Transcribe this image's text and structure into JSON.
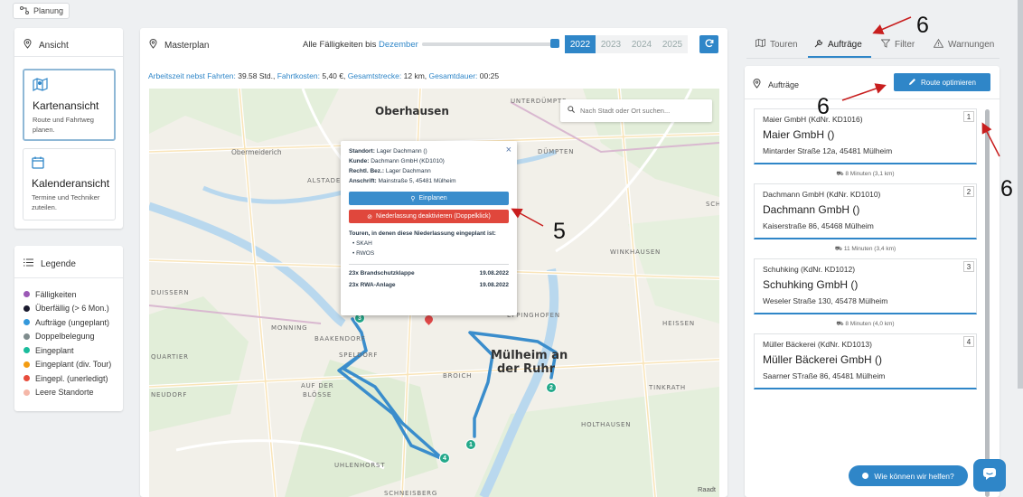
{
  "planning_button": "Planung",
  "view": {
    "title": "Ansicht",
    "map_view": {
      "title": "Kartenansicht",
      "desc": "Route und Fahrtweg planen."
    },
    "calendar_view": {
      "title": "Kalenderansicht",
      "desc": "Termine und Techniker zuteilen."
    }
  },
  "legend": {
    "title": "Legende",
    "items": [
      {
        "label": "Fälligkeiten",
        "color": "#9b59b6"
      },
      {
        "label": "Überfällig (> 6 Mon.)",
        "color": "#1a1a2e"
      },
      {
        "label": "Aufträge (ungeplant)",
        "color": "#3498db"
      },
      {
        "label": "Doppelbelegung",
        "color": "#7f8c8d"
      },
      {
        "label": "Eingeplant",
        "color": "#1abc9c"
      },
      {
        "label": "Eingeplant (div. Tour)",
        "color": "#f39c12"
      },
      {
        "label": "Eingepl. (unerledigt)",
        "color": "#e74c3c"
      },
      {
        "label": "Leere Standorte",
        "color": "#f5b7a8"
      }
    ]
  },
  "master": {
    "title": "Masterplan",
    "due_label": "Alle Fälligkeiten bis",
    "due_month": "Dezember",
    "slider_level": 1.0,
    "years": [
      "2022",
      "2023",
      "2024",
      "2025"
    ],
    "active_year": "2022",
    "summary": {
      "work_label": "Arbeitszeit nebst Fahrten:",
      "work_value": "39.58 Std.",
      "cost_label": "Fahrtkosten:",
      "cost_value": "5,40 €",
      "dist_label": "Gesamtstrecke:",
      "dist_value": "12 km",
      "dur_label": "Gesamtdauer:",
      "dur_value": "00:25"
    }
  },
  "map": {
    "search_placeholder": "Nach Stadt oder Ort suchen...",
    "attribution": "Raadt",
    "labels": {
      "oberhausen": "Oberhausen",
      "muelheim1": "Mülheim an",
      "muelheim2": "der Ruhr",
      "obermeiderich": "Obermeiderich",
      "alstaden": "ALSTADE",
      "duempten": "DÜMPTEN",
      "winkhausen": "WINKHAUSEN",
      "duissern": "DUISSERN",
      "heissen": "HEISSEN",
      "monning": "MONNING",
      "baakendorf": "BAAKENDORF",
      "quartier": "QUARTIER",
      "speldorf": "SPELDORF",
      "broich": "BROICH",
      "neudorf": "NEUDORF",
      "aufderbloesse": "AUF DER",
      "bloesse": "BLÖSSE",
      "tinkrath": "TINKRATH",
      "holthausen": "HOLTHAUSEN",
      "uhlenhorst": "UHLENHORST",
      "schneisberg": "SCHNEISBERG",
      "eppinghofen": "EPPINGHOFEN",
      "unterduempte": "UNTERDÜMPTE",
      "sch": "SCH"
    },
    "markers": [
      "1",
      "2",
      "3",
      "4"
    ]
  },
  "popup": {
    "standort_label": "Standort:",
    "standort": "Lager Dachmann ()",
    "kunde_label": "Kunde:",
    "kunde": "Dachmann GmbH (KD1010)",
    "recht_label": "Rechtl. Bez.:",
    "recht": "Lager Dachmann",
    "anschrift_label": "Anschrift:",
    "anschrift": "Mainstraße 5, 45481 Mülheim",
    "plan_btn": "Einplanen",
    "deactivate_btn": "Niederlassung deaktivieren (Doppelklick)",
    "tours_title": "Touren, in denen diese Niederlassung eingeplant ist:",
    "tours": [
      "SKAH",
      "RWOS"
    ],
    "tasks": [
      {
        "label": "23x Brandschutzklappe",
        "date": "19.08.2022"
      },
      {
        "label": "23x RWA-Anlage",
        "date": "19.08.2022"
      }
    ]
  },
  "tabs": [
    {
      "label": "Touren",
      "icon": "map-icon"
    },
    {
      "label": "Aufträge",
      "icon": "wrench-icon",
      "active": true
    },
    {
      "label": "Filter",
      "icon": "filter-icon"
    },
    {
      "label": "Warnungen",
      "icon": "warning-icon"
    }
  ],
  "orders_panel": {
    "title": "Aufträge",
    "optimize_btn": "Route optimieren",
    "orders": [
      {
        "num": "1",
        "small": "Maier GmbH (KdNr. KD1016)",
        "big": "Maier GmbH ()",
        "addr": "Mintarder Straße 12a, 45481 Mülheim"
      },
      {
        "num": "2",
        "small": "Dachmann GmbH (KdNr. KD1010)",
        "big": "Dachmann GmbH ()",
        "addr": "Kaiserstraße 86, 45468 Mülheim"
      },
      {
        "num": "3",
        "small": "Schuhking (KdNr. KD1012)",
        "big": "Schuhking GmbH ()",
        "addr": "Weseler Straße 130, 45478 Mülheim"
      },
      {
        "num": "4",
        "small": "Müller Bäckerei (KdNr. KD1013)",
        "big": "Müller Bäckerei GmbH ()",
        "addr": "Saarner STraße 86, 45481 Mülheim"
      }
    ],
    "travel": [
      "8 Minuten (3,1 km)",
      "11 Minuten (3,4 km)",
      "8 Minuten (4,0 km)"
    ]
  },
  "help_button": "Wie können wir helfen?",
  "annotations": [
    "6",
    "6",
    "6",
    "5"
  ]
}
